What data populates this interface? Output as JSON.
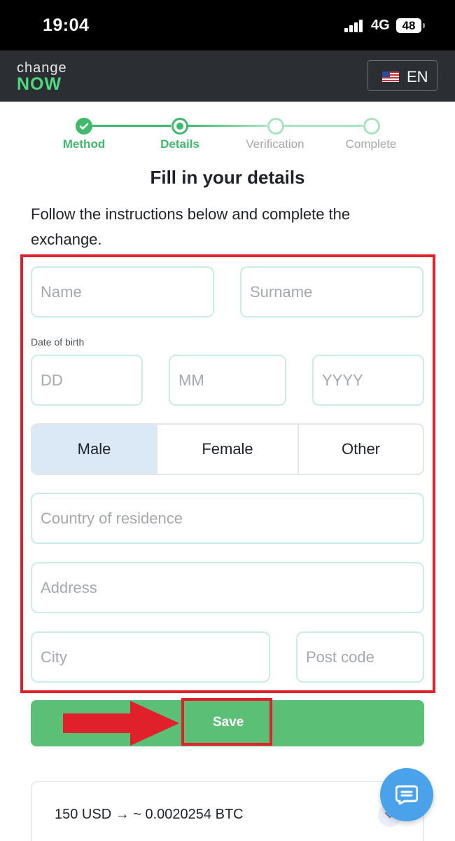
{
  "status_bar": {
    "time": "19:04",
    "network": "4G",
    "battery": "48"
  },
  "header": {
    "logo_top": "change",
    "logo_bottom": "NOW",
    "language": "EN"
  },
  "stepper": {
    "steps": [
      {
        "label": "Method",
        "state": "done"
      },
      {
        "label": "Details",
        "state": "current"
      },
      {
        "label": "Verification",
        "state": "todo"
      },
      {
        "label": "Complete",
        "state": "todo"
      }
    ]
  },
  "page": {
    "title": "Fill in your details",
    "subtitle": "Follow the instructions below and complete the exchange."
  },
  "form": {
    "name_placeholder": "Name",
    "surname_placeholder": "Surname",
    "dob_label": "Date of birth",
    "dd_placeholder": "DD",
    "mm_placeholder": "MM",
    "yyyy_placeholder": "YYYY",
    "gender": {
      "male": "Male",
      "female": "Female",
      "other": "Other",
      "selected": "Male"
    },
    "country_placeholder": "Country of residence",
    "address_placeholder": "Address",
    "city_placeholder": "City",
    "postcode_placeholder": "Post code"
  },
  "actions": {
    "save_label": "Save"
  },
  "summary": {
    "exchange": "150 USD → ~ 0.0020254 BTC"
  },
  "colors": {
    "accent_green": "#3fba6c",
    "save_green": "#5bbf76",
    "highlight_red": "#e0202a",
    "header_bg": "#2b2f33",
    "chat_blue": "#4aa3ea"
  }
}
